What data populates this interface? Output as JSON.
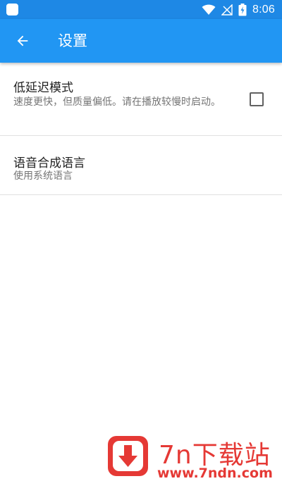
{
  "status_bar": {
    "time": "8:06",
    "icons": [
      "app-notification-icon",
      "wifi-icon",
      "no-signal-icon",
      "battery-charging-icon"
    ]
  },
  "toolbar": {
    "back_icon": "arrow-back-icon",
    "title": "设置"
  },
  "preferences": [
    {
      "title": "低延迟模式",
      "summary": "速度更快，但质量偏低。请在播放较慢时启动。",
      "checked": false
    },
    {
      "title": "语音合成语言",
      "summary": "使用系统语言"
    }
  ],
  "watermark": {
    "name": "7n下载站",
    "url": "www.7ndn.com"
  },
  "colors": {
    "status_bar": "#1E88E5",
    "toolbar": "#2196F3",
    "watermark": "#E53935"
  }
}
